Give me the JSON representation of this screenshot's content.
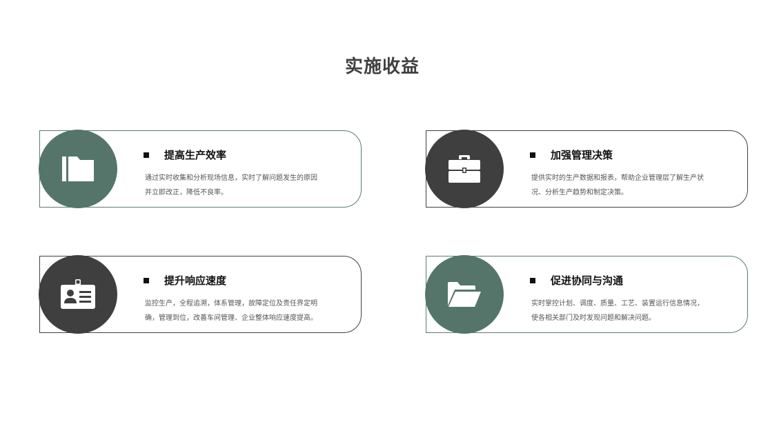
{
  "page": {
    "title": "实施收益"
  },
  "cards": [
    {
      "title": "提高生产效率",
      "body": "通过实时收集和分析现场信息，实时了解问题发生的原因并立即改正，降低不良率。",
      "icon": "folder-icon",
      "circle_color": "#55756b"
    },
    {
      "title": "加强管理决策",
      "body": "提供实时的生产数据和报表，帮助企业管理层了解生产状况、分析生产趋势和制定决策。",
      "icon": "briefcase-icon",
      "circle_color": "#3f3f3f"
    },
    {
      "title": "提升响应速度",
      "body": "监控生产，全程追溯，体系管理，故障定位及责任界定明确，管理到位，改善车间管理、企业整体响应速度提高。",
      "icon": "id-badge-icon",
      "circle_color": "#3f3f3f"
    },
    {
      "title": "促进协同与沟通",
      "body": "实时掌控计划、调度、质量、工艺、装置运行信息情况，使各相关部门及时发现问题和解决问题。",
      "icon": "folder-open-icon",
      "circle_color": "#55756b"
    }
  ]
}
